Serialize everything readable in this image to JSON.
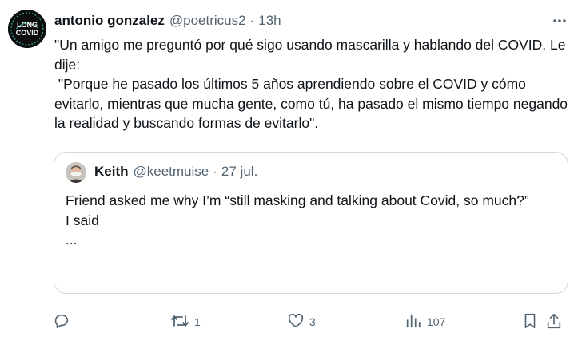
{
  "tweet": {
    "author_name": "antonio gonzalez",
    "author_handle": "@poetricus2",
    "separator": "·",
    "time": "13h",
    "avatar_text": {
      "top": "LONG",
      "bottom": "COVID"
    },
    "text_lines": [
      "\"Un amigo me preguntó por qué sigo usando mascarilla y hablando del COVID. Le dije:",
      " \"Porque he pasado los últimos 5 años aprendiendo sobre el COVID y cómo evitarlo, mientras que mucha gente, como tú, ha pasado el mismo tiempo negando la realidad y buscando formas de evitarlo\"."
    ]
  },
  "quoted": {
    "author_name": "Keith",
    "author_handle": "@keetmuise",
    "separator": "·",
    "date": "27 jul.",
    "lines": [
      "Friend asked me why I’m “still masking and talking about Covid, so much?”",
      " ",
      "I said",
      "..."
    ]
  },
  "actions": {
    "reply": {
      "icon": "reply-icon",
      "count": ""
    },
    "retweet": {
      "icon": "retweet-icon",
      "count": "1"
    },
    "like": {
      "icon": "heart-icon",
      "count": "3"
    },
    "views": {
      "icon": "views-icon",
      "count": "107"
    },
    "bookmark": {
      "icon": "bookmark-icon"
    },
    "share": {
      "icon": "share-icon"
    }
  },
  "colors": {
    "text": "#0f1419",
    "secondary": "#536471",
    "border": "#cfd9de",
    "accent": "#1d9bf0"
  }
}
